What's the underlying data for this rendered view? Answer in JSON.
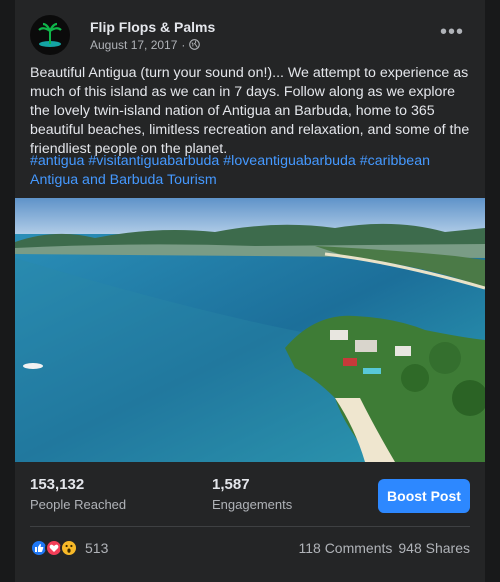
{
  "post": {
    "page_name": "Flip Flops & Palms",
    "date": "August 17, 2017",
    "privacy_icon": "globe-icon",
    "more_icon": "more-options-icon",
    "text": "Beautiful Antigua (turn your sound on!)... We attempt to experience as much of this island as we can in 7 days. Follow along as we explore the lovely twin-island nation of Antigua an Barbuda, home to 365 beautiful beaches, limitless recreation and relaxation, and some of the friendliest people on the planet.",
    "hashtags": [
      "#antigua",
      "#visitantiguabarbuda",
      "#loveantiguabarbuda",
      "#caribbean"
    ],
    "tagged_page": "Antigua and Barbuda Tourism",
    "photo_icon": "aerial-island-photo"
  },
  "insights": {
    "reached_value": "153,132",
    "reached_label": "People Reached",
    "engagements_value": "1,587",
    "engagements_label": "Engagements",
    "boost_label": "Boost Post"
  },
  "footer": {
    "reactions_count": "513",
    "reaction_icons": [
      "like-icon",
      "love-icon",
      "wow-icon"
    ],
    "comments": "118 Comments",
    "shares": "948 Shares"
  },
  "colors": {
    "background": "#18191a",
    "card": "#242526",
    "link": "#4599ff",
    "boost": "#2d88ff"
  }
}
